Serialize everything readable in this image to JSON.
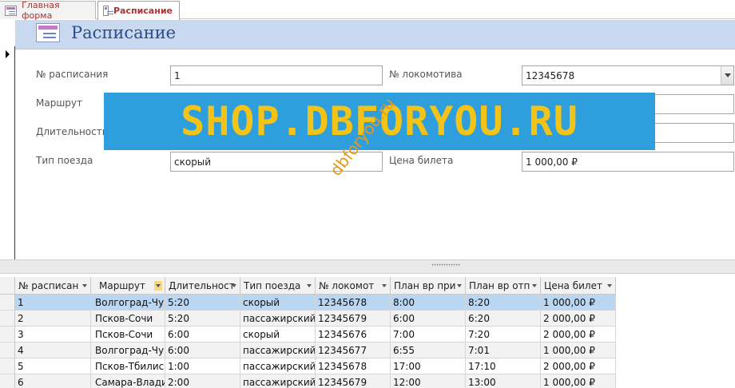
{
  "tabs": [
    {
      "label": "Главная форма",
      "active": false
    },
    {
      "label": "Расписание",
      "active": true
    }
  ],
  "header": {
    "title": "Расписание"
  },
  "form": {
    "schedule_no": {
      "label": "№ расписания",
      "value": "1"
    },
    "route": {
      "label": "Маршрут",
      "value": ""
    },
    "duration": {
      "label": "Длительность",
      "value": ""
    },
    "train_type": {
      "label": "Тип поезда",
      "value": "скорый"
    },
    "loco_no": {
      "label": "№ локомотива",
      "value": "12345678"
    },
    "field_right_2": {
      "value": ""
    },
    "field_right_3": {
      "value": ""
    },
    "ticket_price": {
      "label": "Цена билета",
      "value": "1 000,00 ₽"
    }
  },
  "watermark": {
    "banner": "SHOP.DBFORYOU.RU",
    "diagonal": "dbforyou.ru"
  },
  "datasheet": {
    "columns": [
      "№ расписан",
      "Маршрут",
      "Длительност",
      "Тип поезда",
      "№ локомот",
      "План вр при",
      "План вр отп",
      "Цена билет"
    ],
    "rows": [
      [
        "1",
        "Волгоград-Чуг",
        "5:20",
        "скорый",
        "12345678",
        "8:00",
        "8:20",
        "1 000,00 ₽"
      ],
      [
        "2",
        "Псков-Сочи",
        "5:20",
        "пассажирский",
        "12345679",
        "6:00",
        "6:20",
        "2 000,00 ₽"
      ],
      [
        "3",
        "Псков-Сочи",
        "6:00",
        "скорый",
        "12345676",
        "7:00",
        "7:20",
        "2 000,00 ₽"
      ],
      [
        "4",
        "Волгоград-Чуг",
        "6:00",
        "пассажирский",
        "12345677",
        "6:55",
        "7:01",
        "1 000,00 ₽"
      ],
      [
        "5",
        "Псков-Тбилиси",
        "1:00",
        "пассажирский",
        "12345678",
        "17:00",
        "17:10",
        "2 000,00 ₽"
      ],
      [
        "6",
        "Самара-Влади",
        "2:00",
        "пассажирский",
        "12345679",
        "12:00",
        "13:00",
        "1 000,00 ₽"
      ]
    ]
  },
  "colors": {
    "header_band": "#c9d9ef",
    "title": "#2b4d8c",
    "selected_row": "#b9d6f3",
    "tab_text": "#b03030",
    "banner_bg": "#2e9fdc",
    "banner_text": "#f3c417"
  }
}
